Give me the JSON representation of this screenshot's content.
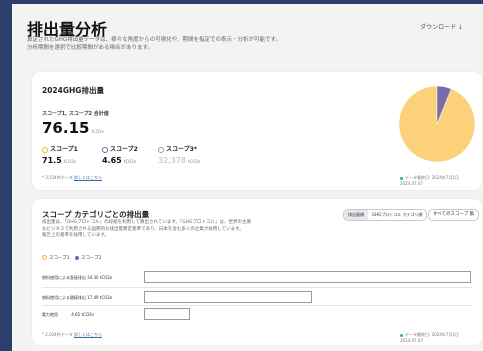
{
  "page": {
    "title": "排出量分析",
    "download_label": "ダウンロード ↓",
    "description_line1": "算定されたGHG排出量データは、様々な角度からの可視化や、期間を指定での表示・分析が可能です。",
    "description_line2": "分析期間を選択で比較期間がある場合があります。"
  },
  "summary_card": {
    "title": "2024GHG排出量",
    "subtitle": "スコープ1, スコープ2 合計値",
    "total_value": "76.15",
    "total_unit": "tCO2e",
    "scopes": [
      {
        "label": "スコープ1",
        "value": "71.5",
        "unit": "tCO2e",
        "color": "#f5b63b"
      },
      {
        "label": "スコープ2",
        "value": "4.65",
        "unit": "tCO2e",
        "color": "#6f63a8"
      },
      {
        "label": "スコープ3*",
        "value": "32,378",
        "unit": "tCO2e",
        "color": "#bbbbbb"
      }
    ],
    "footnote_prefix": "* 3,534件データ",
    "footnote_link": "詳しくはこちら",
    "updated_text": "データ最終日: 2024年7月1日 2024.07.07"
  },
  "category_card": {
    "title": "スコープ カテゴリごとの排出量",
    "description_line1": "排出量は、「GHGプロトコル」の枠組を利用して算出されています。「GHGプロトコル」は、世界の主要",
    "description_line2": "なビジネスで利用される国際的な排出量算定基準であり、日本を含む多くの企業が採用しています。",
    "description_line3": "報告上の基準を採用しています。",
    "toggle_options": [
      "排出量順",
      "GHGプロトコル カテゴリ順"
    ],
    "all_scopes_button": "すべてのスコープ 集",
    "legend": [
      {
        "label": "スコープ1",
        "color": "#f5b63b"
      },
      {
        "label": "スコープ2",
        "color": "#6f63a8"
      }
    ],
    "rows": [
      {
        "label": "燃料使用による直接排出 34.30 tCO2e",
        "value": 34.3
      },
      {
        "label": "燃料使用による間接排出 17.49 tCO2e",
        "value": 17.49
      },
      {
        "label": "電力使用",
        "value_text": "4.65 tCO2e",
        "value": 4.65
      }
    ],
    "footnote_prefix": "* 2,034件データ",
    "footnote_link": "詳しくはこちら",
    "updated_text": "データ最終日: 2024年7月1日 2024.07.07"
  },
  "chart_data": {
    "type": "pie",
    "categories": [
      "スコープ1",
      "スコープ2"
    ],
    "values": [
      71.5,
      4.65
    ],
    "colors": [
      "#fbd27a",
      "#7b6ba8"
    ]
  }
}
